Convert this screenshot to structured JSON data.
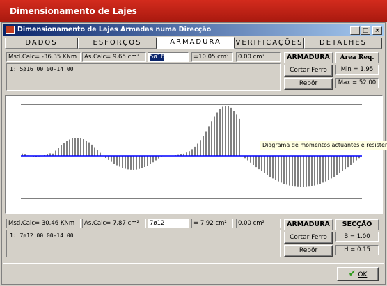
{
  "app_title": "Dimensionamento de Lajes",
  "window": {
    "title": "Dimensionamento de Lajes Armadas numa Direcção",
    "btn_min": "_",
    "btn_max": "□",
    "btn_close": "×"
  },
  "tabs": [
    "DADOS",
    "ESFORÇOS",
    "ARMADURA",
    "VERIFICAÇÕES",
    "DETALHES"
  ],
  "active_tab": "ARMADURA",
  "top": {
    "msd": "Msd.Calc= -36.35 KNm",
    "as_calc": "As.Calc= 9.65 cm²",
    "bars_input": "5ø16",
    "as_result": "=10.05 cm²",
    "as_extra": "0.00 cm²",
    "memo": "1: 5ø16  00.00-14.00",
    "armadura_label": "ARMADURA",
    "cortar_label": "Cortar Ferro",
    "repor_label": "Repôr",
    "area_label": "Area Req.",
    "min_value": "Min = 1.95",
    "max_value": "Max = 52.00"
  },
  "tooltip": "Diagrama de momentos actuantes e resistentes",
  "bottom": {
    "msd": "Msd.Calc=  30.46 KNm",
    "as_calc": "As.Calc= 7.87 cm²",
    "bars_input": "7ø12",
    "as_result": "= 7.92 cm²",
    "as_extra": "0.00 cm²",
    "memo": "1: 7ø12  00.00-14.00",
    "armadura_label": "ARMADURA",
    "cortar_label": "Cortar Ferro",
    "repor_label": "Repôr",
    "seccao_label": "SECÇÃO",
    "b_value": "B = 1.00",
    "h_value": "H = 0.15"
  },
  "ok_label": "OK",
  "colors": {
    "title_red": "#c0201a",
    "axis_blue": "#0000ff",
    "titlebar_blue": "#0a246a"
  }
}
